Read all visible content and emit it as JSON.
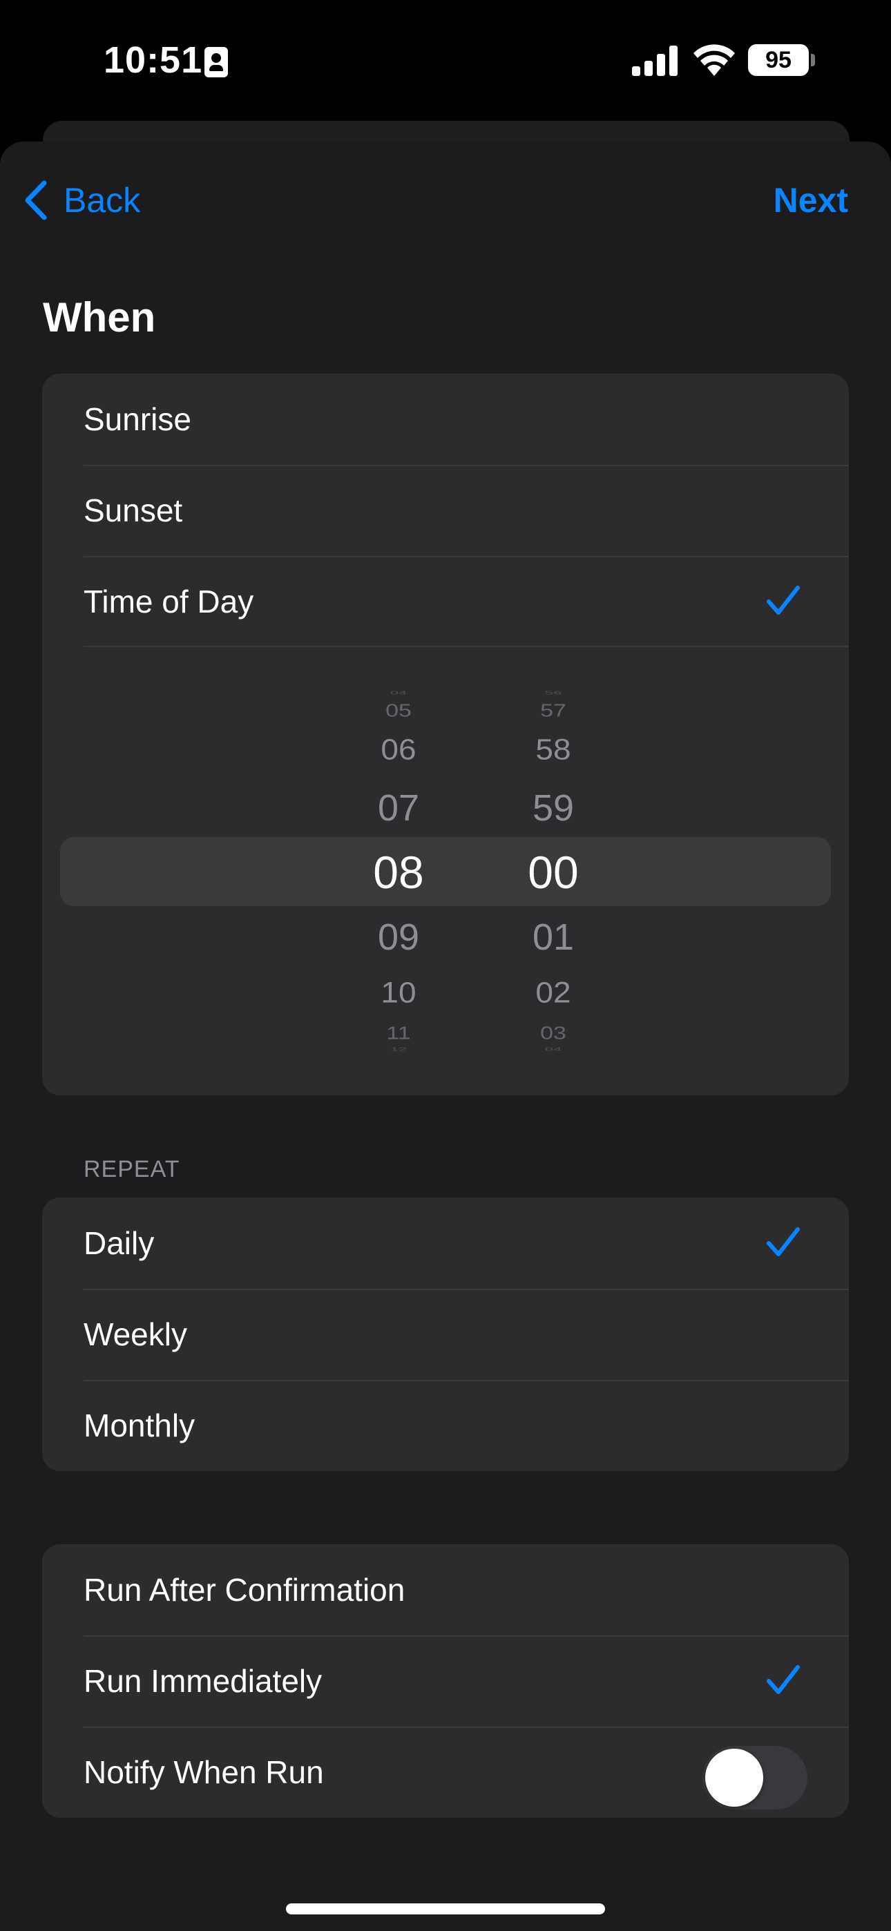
{
  "status_bar": {
    "time": "10:51",
    "battery": "95"
  },
  "nav": {
    "back_label": "Back",
    "next_label": "Next"
  },
  "when": {
    "title": "When",
    "options": [
      {
        "label": "Sunrise",
        "selected": false
      },
      {
        "label": "Sunset",
        "selected": false
      },
      {
        "label": "Time of Day",
        "selected": true
      }
    ]
  },
  "time_picker": {
    "hours": [
      "04",
      "05",
      "06",
      "07",
      "08",
      "09",
      "10",
      "11",
      "12"
    ],
    "minutes": [
      "56",
      "57",
      "58",
      "59",
      "00",
      "01",
      "02",
      "03",
      "04"
    ],
    "selected_hour": "08",
    "selected_minute": "00"
  },
  "repeat": {
    "header": "REPEAT",
    "options": [
      {
        "label": "Daily",
        "selected": true
      },
      {
        "label": "Weekly",
        "selected": false
      },
      {
        "label": "Monthly",
        "selected": false
      }
    ]
  },
  "run": {
    "options": [
      {
        "label": "Run After Confirmation",
        "selected": false
      },
      {
        "label": "Run Immediately",
        "selected": true
      }
    ],
    "notify_label": "Notify When Run",
    "notify_enabled": false
  },
  "colors": {
    "accent": "#0a84ff",
    "background": "#1c1c1e",
    "cell": "#2c2c2e"
  }
}
